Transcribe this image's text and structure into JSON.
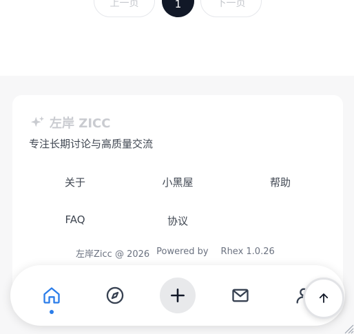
{
  "pagination": {
    "prev_label": "上一页",
    "current_page": "1",
    "next_label": "下一页"
  },
  "footer": {
    "brand_name": "左岸 ZICC",
    "tagline": "专注长期讨论与高质量交流",
    "links": {
      "about": "关于",
      "blackroom": "小黑屋",
      "help": "帮助",
      "faq": "FAQ",
      "agreement": "协议"
    },
    "copyright": "左岸Zicc @ 2026",
    "powered_by": "Powered by",
    "version": "Rhex 1.0.26"
  },
  "bottom_nav": {
    "items": [
      "home-icon",
      "compass-icon",
      "plus-icon",
      "mail-icon",
      "user-icon"
    ],
    "active": "home",
    "accent_color": "#2b7de9"
  },
  "back_to_top": {
    "icon": "arrow-up-icon"
  }
}
